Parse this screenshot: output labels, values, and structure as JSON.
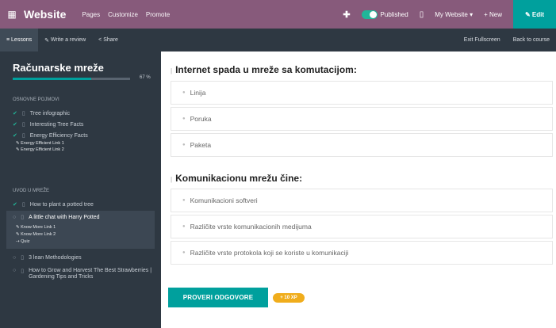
{
  "topbar": {
    "apps_icon": "grid-icon",
    "brand": "Website",
    "menu": [
      "Pages",
      "Customize",
      "Promote"
    ],
    "published_label": "Published",
    "my_website": "My Website ▾",
    "new_label": "+ New",
    "edit_label": "✎ Edit",
    "accent_color": "#875a7b",
    "edit_color": "#00a09d"
  },
  "subbar": {
    "tabs": [
      "Lessons",
      "Write a review",
      "Share"
    ],
    "right_links": [
      "Exit Fullscreen",
      "Back to course"
    ]
  },
  "sidebar": {
    "course_title": "Računarske mreže",
    "progress_text": "67 %",
    "progress_value": 0.67,
    "sections": [
      {
        "title": "Osnovne pojmovi",
        "items": [
          {
            "label": "Tree infographic",
            "done": true
          },
          {
            "label": "Interesting Tree Facts",
            "done": true
          },
          {
            "label": "Energy Efficiency Facts",
            "done": true
          }
        ],
        "links": [
          "Energy Efficient Link 1",
          "Energy Efficient Link 2"
        ]
      },
      {
        "title": "Uvod u mreže",
        "items": [
          {
            "label": "How to plant a potted tree",
            "done": true
          },
          {
            "label": "A little chat with Harry Potted",
            "done": false
          },
          {
            "label": "3 lean Methodologies",
            "done": false
          },
          {
            "label": "How to Grow and Harvest The Best Strawberries | Gardening Tips and Tricks",
            "done": false
          }
        ],
        "links": [
          "Know More Link 1",
          "Know More Link 2",
          "Quiz"
        ]
      }
    ]
  },
  "quiz": {
    "questions": [
      {
        "title": "Internet spada u mreže sa komutacijom:",
        "answers": [
          "Linija",
          "Poruka",
          "Paketa"
        ]
      },
      {
        "title": "Komunikacionu mrežu čine:",
        "answers": [
          "Komunikacioni softveri",
          "Različite vrste komunikacionih medijuma",
          "Različite vrste protokola koji se koriste u komunikaciji"
        ]
      }
    ],
    "check_button": "PROVERI ODGOVORE",
    "xp_badge": "+ 10 XP"
  }
}
